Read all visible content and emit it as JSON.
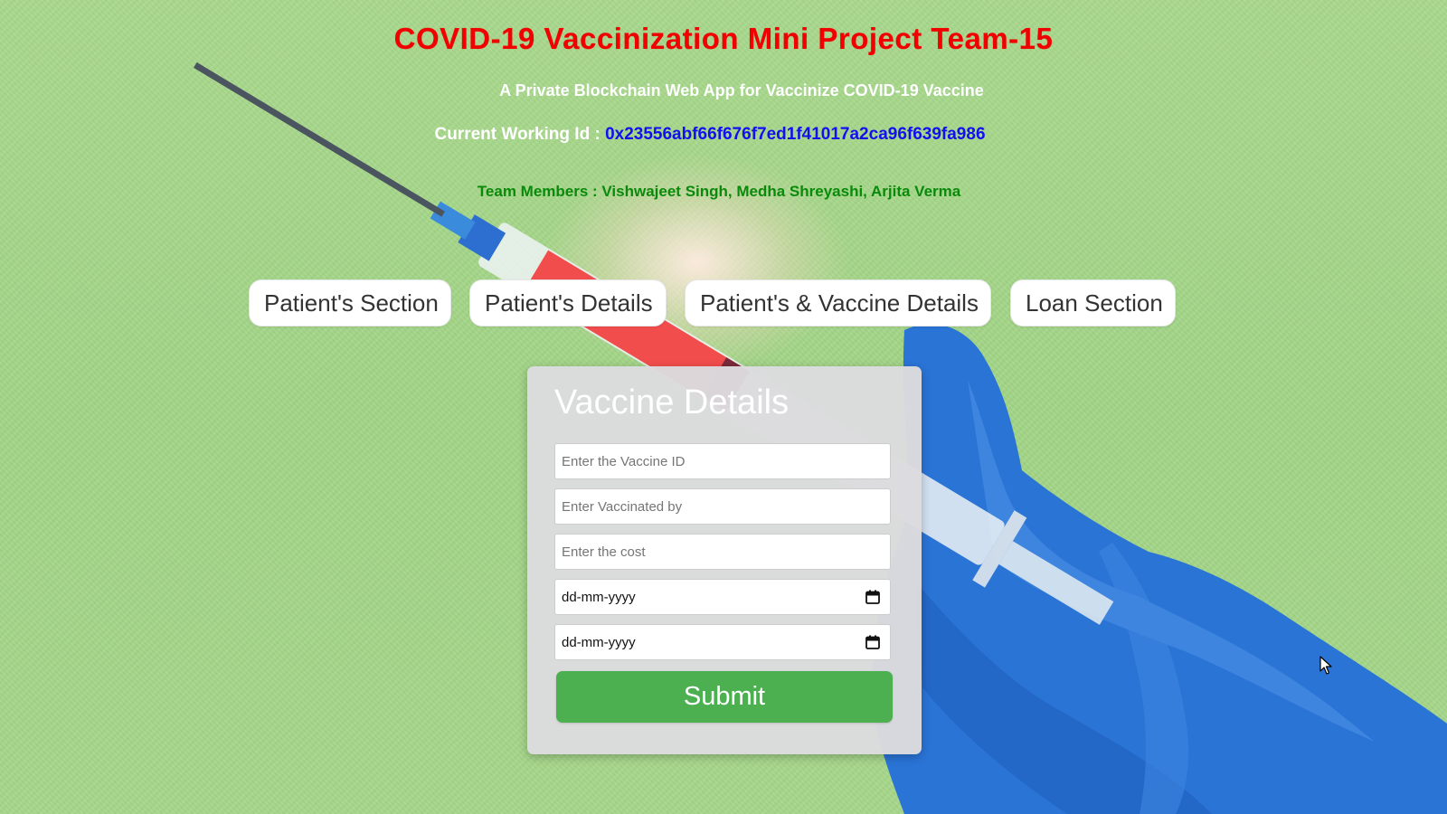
{
  "header": {
    "title": "COVID-19 Vaccinization Mini Project Team-15",
    "subtitle": "A Private Blockchain Web App for Vaccinize COVID-19 Vaccine",
    "working_id_label": "Current Working Id : ",
    "working_id_value": "0x23556abf66f676f7ed1f41017a2ca96f639fa986",
    "team_members": "Team Members : Vishwajeet Singh, Medha Shreyashi, Arjita Verma"
  },
  "nav": {
    "tabs": [
      {
        "label": "Patient's Section"
      },
      {
        "label": "Patient's Details"
      },
      {
        "label": "Patient's & Vaccine Details"
      },
      {
        "label": "Loan Section"
      }
    ]
  },
  "form": {
    "heading": "Vaccine Details",
    "vaccine_id": {
      "placeholder": "Enter the Vaccine ID",
      "value": ""
    },
    "vaccinated_by": {
      "placeholder": "Enter Vaccinated by",
      "value": ""
    },
    "cost": {
      "placeholder": "Enter the cost",
      "value": ""
    },
    "date1": {
      "display": "dd-mm-yyyy"
    },
    "date2": {
      "display": "dd-mm-yyyy"
    },
    "submit_label": "Submit"
  },
  "icons": {
    "calendar": "calendar-icon",
    "cursor": "mouse-cursor-icon"
  },
  "colors": {
    "title": "#f00000",
    "working_id_value": "#1010f0",
    "team_members": "#0a8a0a",
    "submit_bg": "#4caf50",
    "background": "#a6d88a"
  }
}
